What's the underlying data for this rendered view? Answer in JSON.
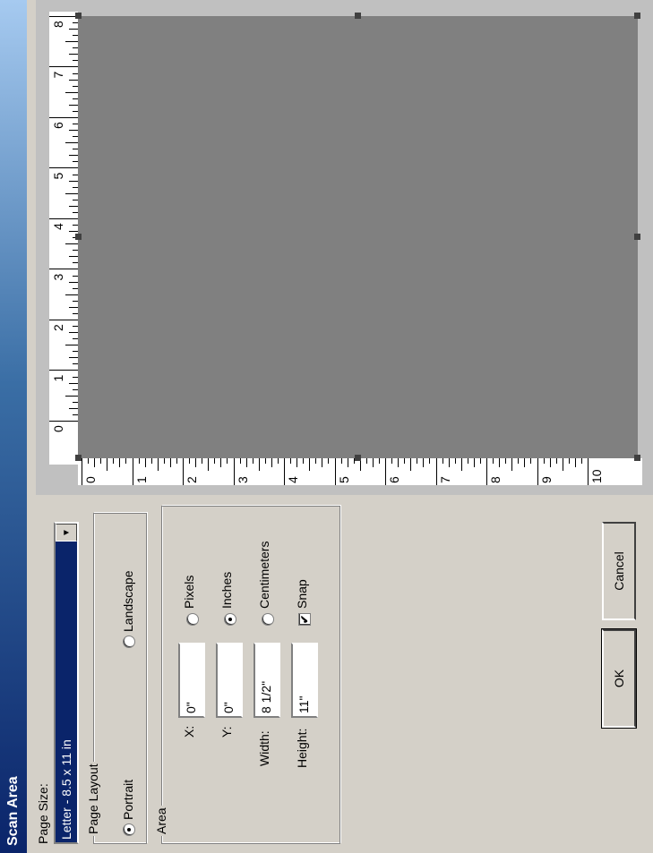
{
  "window": {
    "title": "Scan Area"
  },
  "page_size": {
    "label": "Page Size:",
    "selected": "Letter - 8.5 x 11 in"
  },
  "page_layout": {
    "legend": "Page Layout",
    "portrait": "Portrait",
    "landscape": "Landscape",
    "selected": "portrait"
  },
  "area": {
    "legend": "Area",
    "x_label": "X:",
    "x_value": "0\"",
    "y_label": "Y:",
    "y_value": "0\"",
    "width_label": "Width:",
    "width_value": "8 1/2\"",
    "height_label": "Height:",
    "height_value": "11\"",
    "units": {
      "pixels": "Pixels",
      "inches": "Inches",
      "centimeters": "Centimeters",
      "selected": "inches"
    },
    "snap": {
      "label": "Snap",
      "checked": true
    }
  },
  "buttons": {
    "ok": "OK",
    "cancel": "Cancel"
  },
  "ruler_left": {
    "labels": [
      "8",
      "7",
      "6",
      "5",
      "4",
      "3",
      "2",
      "1",
      "0"
    ]
  },
  "ruler_bottom": {
    "labels": [
      "0",
      "1",
      "2",
      "3",
      "4",
      "5",
      "6",
      "7",
      "8",
      "9",
      "10"
    ]
  },
  "icons": {
    "dropdown": "chevron-down-icon",
    "snap_check": "check-icon"
  }
}
